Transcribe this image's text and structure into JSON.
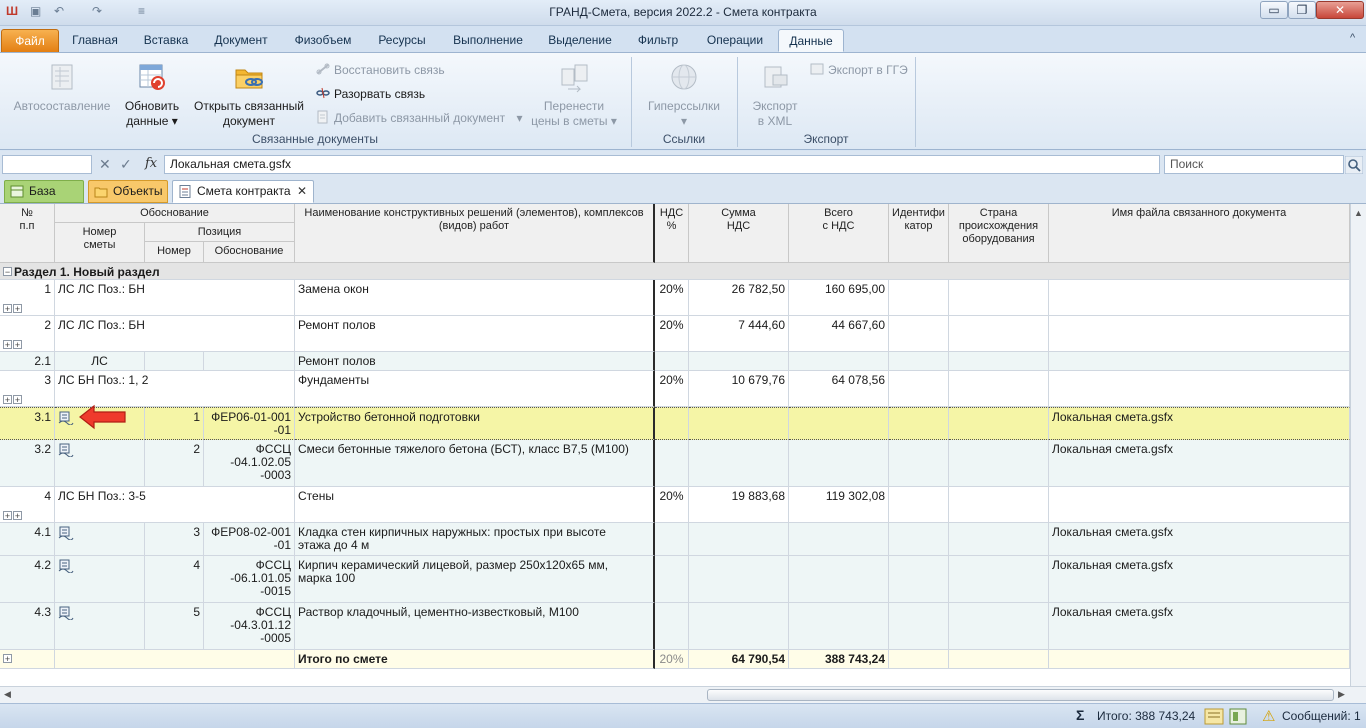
{
  "window": {
    "title": "ГРАНД-Смета, версия 2022.2 - Смета контракта",
    "controls": {
      "minimize": "▭",
      "maximize": "❐",
      "close": "✕"
    }
  },
  "qat": {
    "app_icon": "Ш",
    "save": "▣",
    "undo": "↶",
    "redo": "↷",
    "customize": "≡"
  },
  "ribbon": {
    "tabs": [
      "Файл",
      "Главная",
      "Вставка",
      "Документ",
      "Физобъем",
      "Ресурсы",
      "Выполнение",
      "Выделение",
      "Фильтр",
      "Операции",
      "Данные"
    ],
    "active_tab": "Данные",
    "groups": {
      "linked_docs": {
        "label": "Связанные документы",
        "autocompose": "Автосоставление",
        "refresh_line1": "Обновить",
        "refresh_line2": "данные",
        "open_linked_line1": "Открыть связанный",
        "open_linked_line2": "документ",
        "restore_link": "Восстановить связь",
        "break_link": "Разорвать связь",
        "add_linked": "Добавить связанный документ",
        "transfer_line1": "Перенести",
        "transfer_line2": "цены в сметы"
      },
      "links": {
        "label": "Ссылки",
        "hyperlinks": "Гиперссылки"
      },
      "export": {
        "label": "Экспорт",
        "xml_line1": "Экспорт",
        "xml_line2": "в XML",
        "gge": "Экспорт в ГГЭ"
      }
    },
    "dropdown_arrow": "▾",
    "expand_arrow": "^"
  },
  "formula_bar": {
    "name_box": "",
    "cancel": "✕",
    "confirm": "✓",
    "fx": "fx",
    "value": "Локальная смета.gsfx",
    "search_placeholder": "Поиск"
  },
  "doc_tabs": [
    {
      "label": "База",
      "color": "#8bc34a"
    },
    {
      "label": "Объекты",
      "color": "#f5b642"
    },
    {
      "label": "Смета контракта",
      "color": "#ffffff",
      "close": "✕"
    }
  ],
  "grid": {
    "headers": {
      "num": "№\nп.п",
      "basis": "Обоснование",
      "estimate_num": "Номер\nсметы",
      "position": "Позиция",
      "pos_num": "Номер",
      "pos_basis": "Обоснование",
      "name": "Наименование конструктивных решений (элементов), комплексов\n(видов) работ",
      "vat_pct": "НДС\n%",
      "vat_sum": "Сумма\nНДС",
      "total": "Всего\nс НДС",
      "identifier": "Идентифи\nкатор",
      "country": "Страна\nпроисхождения\nоборудования",
      "linked_file": "Имя файла связанного документа"
    },
    "section": "Раздел 1. Новый раздел",
    "rows": [
      {
        "n": "1",
        "basis": "ЛС ЛС Поз.: БН",
        "name": "Замена окон",
        "vat": "20%",
        "vat_sum": "26 782,50",
        "total": "160 695,00",
        "file": ""
      },
      {
        "n": "2",
        "basis": "ЛС ЛС Поз.: БН",
        "name": "Ремонт полов",
        "vat": "20%",
        "vat_sum": "7 444,60",
        "total": "44 667,60",
        "file": ""
      },
      {
        "n": "2.1",
        "basis": "ЛС",
        "name": "Ремонт полов",
        "vat": "",
        "vat_sum": "",
        "total": "",
        "file": ""
      },
      {
        "n": "3",
        "basis": "ЛС БН Поз.: 1, 2",
        "name": "Фундаменты",
        "vat": "20%",
        "vat_sum": "10 679,76",
        "total": "64 078,56",
        "file": ""
      },
      {
        "n": "3.1",
        "pos": "1",
        "pos_basis": "ФЕР06-01-001\n-01",
        "name": "Устройство бетонной подготовки",
        "file": "Локальная смета.gsfx"
      },
      {
        "n": "3.2",
        "pos": "2",
        "pos_basis": "ФССЦ\n-04.1.02.05\n-0003",
        "name": "Смеси бетонные тяжелого бетона (БСТ), класс В7,5 (М100)",
        "file": "Локальная смета.gsfx"
      },
      {
        "n": "4",
        "basis": "ЛС БН Поз.: 3-5",
        "name": "Стены",
        "vat": "20%",
        "vat_sum": "19 883,68",
        "total": "119 302,08",
        "file": ""
      },
      {
        "n": "4.1",
        "pos": "3",
        "pos_basis": "ФЕР08-02-001\n-01",
        "name": "Кладка стен кирпичных наружных: простых при высоте\nэтажа до 4 м",
        "file": "Локальная смета.gsfx"
      },
      {
        "n": "4.2",
        "pos": "4",
        "pos_basis": "ФССЦ\n-06.1.01.05\n-0015",
        "name": "Кирпич керамический лицевой, размер 250х120х65 мм,\nмарка 100",
        "file": "Локальная смета.gsfx"
      },
      {
        "n": "4.3",
        "pos": "5",
        "pos_basis": "ФССЦ\n-04.3.01.12\n-0005",
        "name": "Раствор кладочный, цементно-известковый, М100",
        "file": "Локальная смета.gsfx"
      }
    ],
    "totals": {
      "label": "Итого по смете",
      "vat": "20%",
      "vat_sum": "64 790,54",
      "total": "388 743,24"
    },
    "expand_symbol": "+",
    "collapse_symbol": "−"
  },
  "status_bar": {
    "sum_icon": "Σ",
    "sum": "Итого: 388 743,24",
    "messages": "Сообщений: 1",
    "warn_icon": "⚠"
  },
  "colors": {
    "accent_file_tab": "#e8891b",
    "selected_row": "#f5f5a6",
    "sub_row": "#eef6f6",
    "section_row": "#e4e4e4",
    "totals_row": "#fffde8",
    "pointer_arrow": "#e8322a"
  }
}
